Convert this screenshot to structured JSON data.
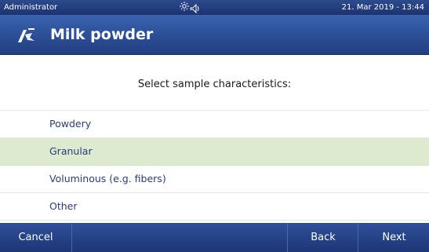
{
  "status_bar": {
    "user": "Administrator",
    "datetime": "21. Mar 2019 - 13:44",
    "icons": [
      "sun-icon",
      "speaker-icon"
    ]
  },
  "header": {
    "icon": "method-icon",
    "title": "Milk powder"
  },
  "main": {
    "prompt": "Select sample characteristics:",
    "options": [
      {
        "label": "Powdery",
        "selected": false
      },
      {
        "label": "Granular",
        "selected": true
      },
      {
        "label": "Voluminous (e.g. fibers)",
        "selected": false
      },
      {
        "label": "Other",
        "selected": false
      }
    ]
  },
  "footer": {
    "cancel_label": "Cancel",
    "back_label": "Back",
    "next_label": "Next"
  },
  "colors": {
    "header_blue": "#2a4c93",
    "selected_row": "#dcebcf",
    "option_text": "#2d3a78"
  }
}
